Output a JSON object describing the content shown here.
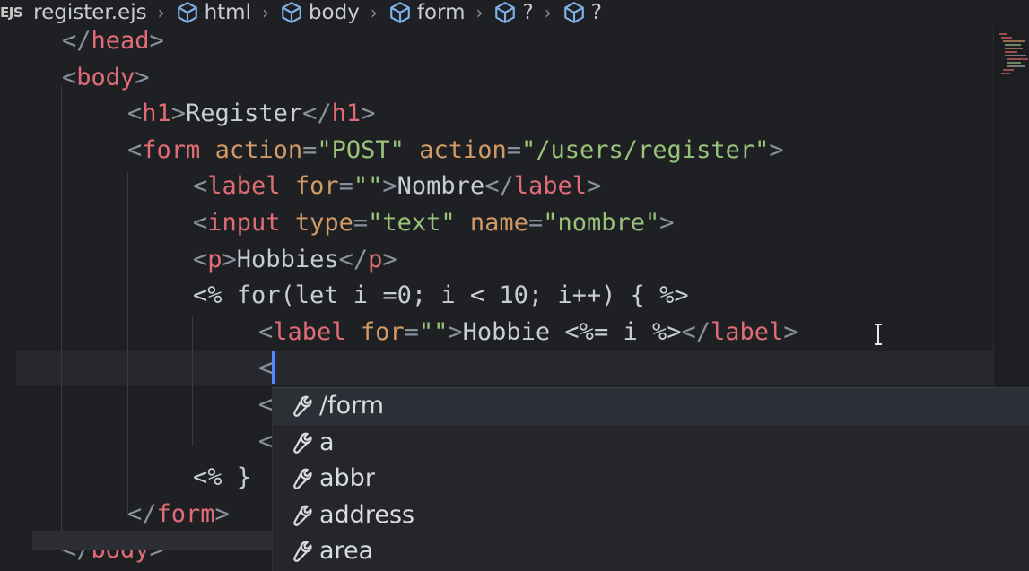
{
  "breadcrumb": {
    "file_icon": "EJS",
    "file_name": "register.ejs",
    "items": [
      "html",
      "body",
      "form",
      "?",
      "?"
    ]
  },
  "editor": {
    "lines": [
      {
        "indent": 2,
        "tokens": [
          [
            "punct",
            "</"
          ],
          [
            "tag",
            "head"
          ],
          [
            "punct",
            ">"
          ]
        ]
      },
      {
        "indent": 2,
        "tokens": [
          [
            "punct",
            "<"
          ],
          [
            "tag",
            "body"
          ],
          [
            "punct",
            ">"
          ]
        ]
      },
      {
        "indent": 4,
        "tokens": [
          [
            "punct",
            "<"
          ],
          [
            "tag",
            "h1"
          ],
          [
            "punct",
            ">"
          ],
          [
            "text",
            "Register"
          ],
          [
            "punct",
            "</"
          ],
          [
            "tag",
            "h1"
          ],
          [
            "punct",
            ">"
          ]
        ]
      },
      {
        "indent": 4,
        "tokens": [
          [
            "punct",
            "<"
          ],
          [
            "tag",
            "form"
          ],
          [
            "text",
            " "
          ],
          [
            "attr",
            "action"
          ],
          [
            "punct",
            "="
          ],
          [
            "str",
            "\"POST\""
          ],
          [
            "text",
            " "
          ],
          [
            "attr",
            "action"
          ],
          [
            "punct",
            "="
          ],
          [
            "str",
            "\"/users/register\""
          ],
          [
            "punct",
            ">"
          ]
        ]
      },
      {
        "indent": 6,
        "tokens": [
          [
            "punct",
            "<"
          ],
          [
            "tag",
            "label"
          ],
          [
            "text",
            " "
          ],
          [
            "attr",
            "for"
          ],
          [
            "punct",
            "="
          ],
          [
            "str",
            "\"\""
          ],
          [
            "punct",
            ">"
          ],
          [
            "text",
            "Nombre"
          ],
          [
            "punct",
            "</"
          ],
          [
            "tag",
            "label"
          ],
          [
            "punct",
            ">"
          ]
        ]
      },
      {
        "indent": 6,
        "tokens": [
          [
            "punct",
            "<"
          ],
          [
            "tag",
            "input"
          ],
          [
            "text",
            " "
          ],
          [
            "attr",
            "type"
          ],
          [
            "punct",
            "="
          ],
          [
            "str",
            "\"text\""
          ],
          [
            "text",
            " "
          ],
          [
            "attr",
            "name"
          ],
          [
            "punct",
            "="
          ],
          [
            "str",
            "\"nombre\""
          ],
          [
            "punct",
            ">"
          ]
        ]
      },
      {
        "indent": 6,
        "tokens": [
          [
            "punct",
            "<"
          ],
          [
            "tag",
            "p"
          ],
          [
            "punct",
            ">"
          ],
          [
            "text",
            "Hobbies"
          ],
          [
            "punct",
            "</"
          ],
          [
            "tag",
            "p"
          ],
          [
            "punct",
            ">"
          ]
        ]
      },
      {
        "indent": 6,
        "tokens": [
          [
            "ejs",
            "<% for(let i =0; i < 10; i++) { %>"
          ]
        ]
      },
      {
        "indent": 8,
        "tokens": [
          [
            "punct",
            "<"
          ],
          [
            "tag",
            "label"
          ],
          [
            "text",
            " "
          ],
          [
            "attr",
            "for"
          ],
          [
            "punct",
            "="
          ],
          [
            "str",
            "\"\""
          ],
          [
            "punct",
            ">"
          ],
          [
            "text",
            "Hobbie <%= i %>"
          ],
          [
            "punct",
            "</"
          ],
          [
            "tag",
            "label"
          ],
          [
            "punct",
            ">"
          ]
        ]
      },
      {
        "indent": 8,
        "tokens": [
          [
            "punct",
            "<"
          ]
        ]
      },
      {
        "indent": 8,
        "tokens": [
          [
            "punct",
            "<"
          ]
        ]
      },
      {
        "indent": 8,
        "tokens": [
          [
            "punct",
            "<"
          ]
        ]
      },
      {
        "indent": 6,
        "tokens": [
          [
            "ejs",
            "<% }"
          ]
        ]
      },
      {
        "indent": 4,
        "tokens": [
          [
            "punct",
            "</"
          ],
          [
            "tag",
            "form"
          ],
          [
            "punct",
            ">"
          ]
        ]
      },
      {
        "indent": 2,
        "tokens": [
          [
            "punct",
            "</"
          ],
          [
            "tag",
            "body"
          ],
          [
            "punct",
            ">"
          ]
        ]
      }
    ]
  },
  "autocomplete": {
    "items": [
      "/form",
      "a",
      "abbr",
      "address",
      "area"
    ],
    "item_icon": "wrench-icon"
  },
  "colors": {
    "background": "#1f2024",
    "tag": "#e06c75",
    "attribute": "#d19a66",
    "string": "#98c379",
    "cursor": "#528bff"
  }
}
